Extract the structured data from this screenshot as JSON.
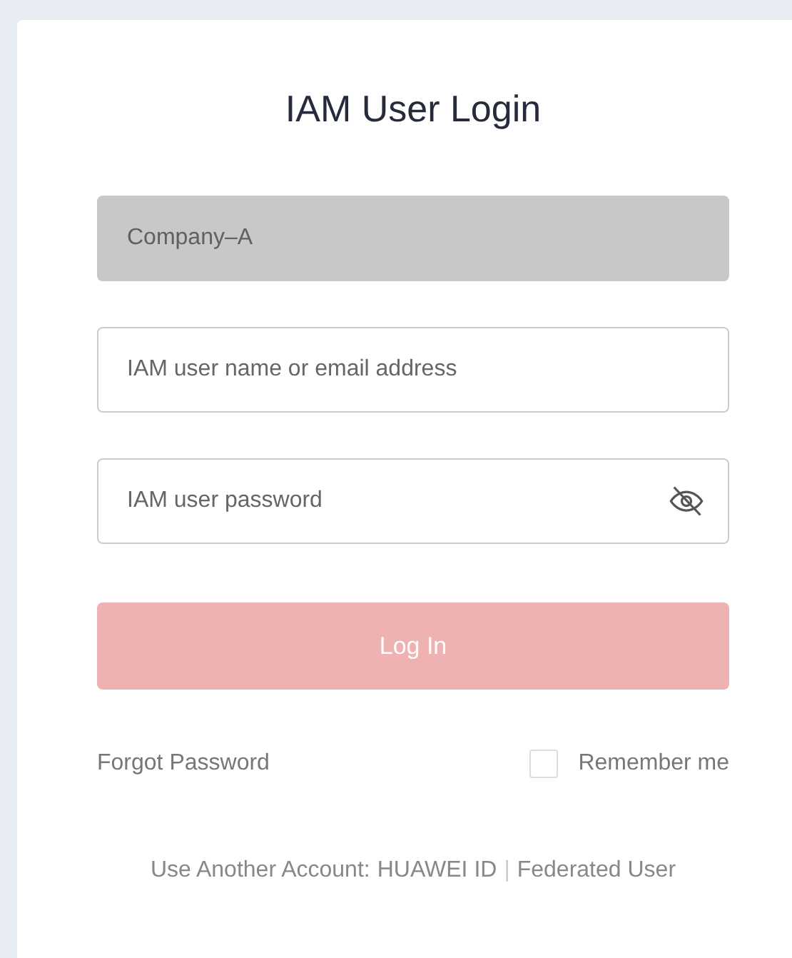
{
  "title": "IAM User Login",
  "fields": [
    {
      "kind": "text",
      "value": "Company–A",
      "disabled": true
    },
    {
      "kind": "text",
      "placeholder": "IAM user name or email address",
      "disabled": false
    },
    {
      "kind": "password",
      "placeholder": "IAM user password",
      "disabled": false,
      "revealed": false
    }
  ],
  "login_button": {
    "label": "Log In",
    "disabled": true
  },
  "forgot_link": "Forgot Password",
  "remember": {
    "label": "Remember me",
    "checked": false
  },
  "footer": {
    "prefix": "Use Another Account:",
    "links": [
      "HUAWEI ID",
      "Federated User"
    ],
    "separator": "|"
  }
}
